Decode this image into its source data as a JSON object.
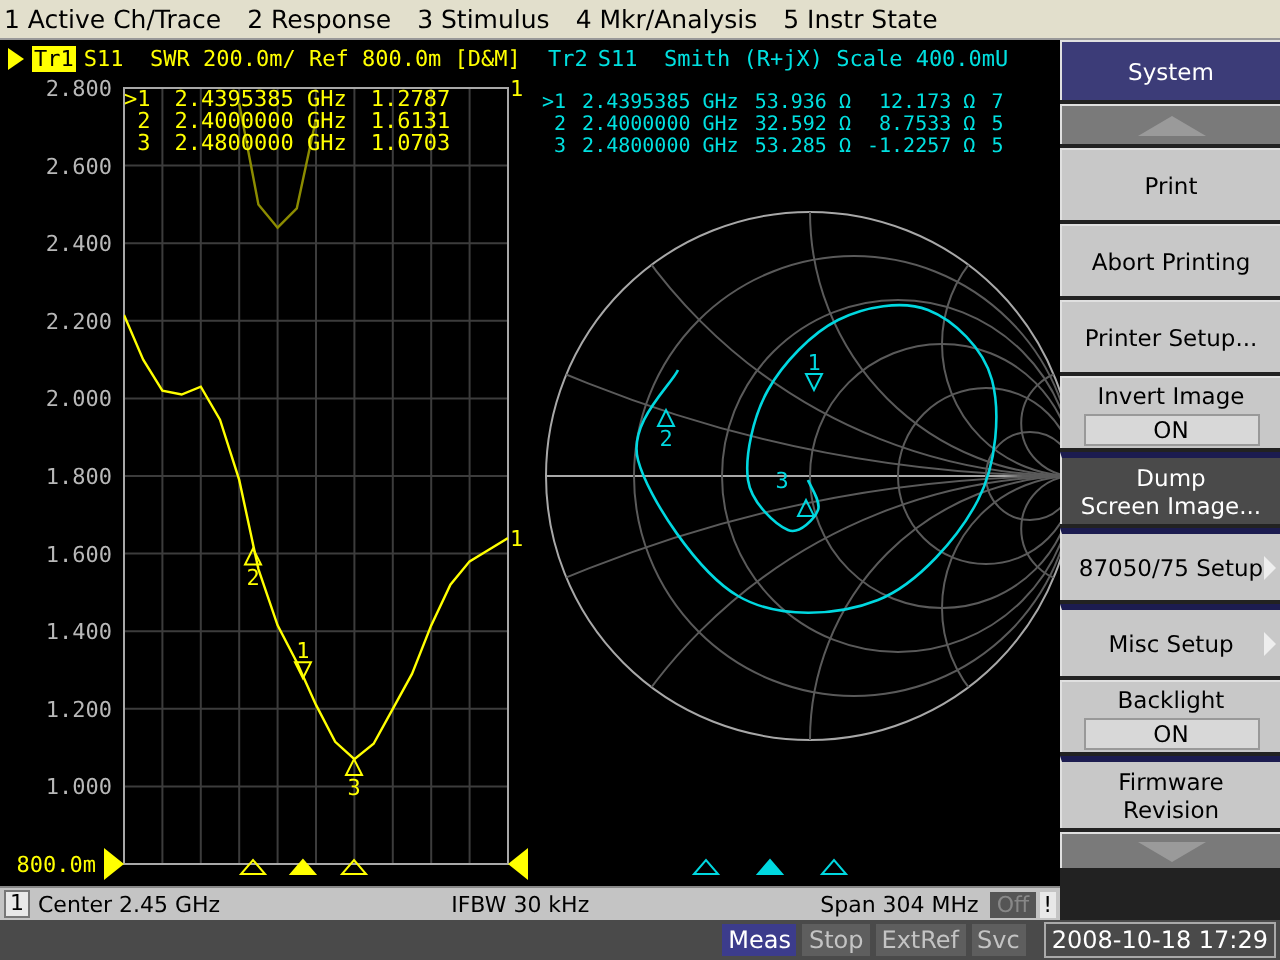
{
  "menu_bar": [
    "1 Active Ch/Trace",
    "2 Response",
    "3 Stimulus",
    "4 Mkr/Analysis",
    "5 Instr State"
  ],
  "trace1": {
    "label": "Tr1",
    "active": true,
    "header": "S11  SWR 200.0m/ Ref 800.0m [D&M]",
    "ref_value": "800.0m",
    "channel_marks": [
      "1",
      "1"
    ],
    "markers": [
      {
        "label": ">1",
        "frequency": "2.4395385 GHz",
        "value": "1.2787",
        "selected": true
      },
      {
        "label": "2",
        "frequency": "2.4000000 GHz",
        "value": "1.6131",
        "selected": false
      },
      {
        "label": "3",
        "frequency": "2.4800000 GHz",
        "value": "1.0703",
        "selected": false
      }
    ],
    "marker_labels": [
      "1",
      "2",
      "3"
    ],
    "chart_data": {
      "type": "line",
      "grid": true,
      "ylim": [
        0.8,
        2.8
      ],
      "yticks": [
        {
          "value": 2.8,
          "label": "2.800"
        },
        {
          "value": 2.6,
          "label": "2.600"
        },
        {
          "value": 2.4,
          "label": "2.400"
        },
        {
          "value": 2.2,
          "label": "2.200"
        },
        {
          "value": 2.0,
          "label": "2.000"
        },
        {
          "value": 1.8,
          "label": "1.800"
        },
        {
          "value": 1.6,
          "label": "1.600"
        },
        {
          "value": 1.4,
          "label": "1.400"
        },
        {
          "value": 1.2,
          "label": "1.200"
        },
        {
          "value": 1.0,
          "label": "1.000"
        }
      ],
      "series": [
        {
          "color": "#ffff00",
          "values": [
            2.215,
            2.1,
            2.02,
            2.01,
            2.03,
            1.945,
            1.79,
            1.56,
            1.415,
            1.32,
            1.21,
            1.115,
            1.07,
            1.11,
            1.2,
            1.29,
            1.415,
            1.52,
            1.58,
            1.61,
            1.64
          ]
        },
        {
          "color": "#8c8c00",
          "values": [
            null,
            null,
            null,
            null,
            null,
            null,
            2.76,
            2.5,
            2.44,
            2.49,
            2.72,
            null,
            null,
            null,
            null,
            null,
            null,
            null,
            null,
            null,
            null
          ]
        }
      ]
    }
  },
  "trace2": {
    "label": "Tr2",
    "active": false,
    "header": "S11  Smith (R+jX) Scale 400.0mU",
    "markers": [
      {
        "label": ">1",
        "frequency": "2.4395385 GHz",
        "resistance": "53.936 Ω",
        "reactance": "12.173 Ω",
        "column_5": "7",
        "selected": true
      },
      {
        "label": "2",
        "frequency": "2.4000000 GHz",
        "resistance": "32.592 Ω",
        "reactance": "8.7533 Ω",
        "column_5": "5",
        "selected": false
      },
      {
        "label": "3",
        "frequency": "2.4800000 GHz",
        "resistance": "53.285 Ω",
        "reactance": "-1.2257 Ω",
        "column_5": "5",
        "selected": false
      }
    ],
    "marker_labels": [
      "1",
      "2",
      "3"
    ]
  },
  "status_line": {
    "channel": "1",
    "center": "Center 2.45 GHz",
    "ifbw": "IFBW 30 kHz",
    "span": "Span 304 MHz",
    "off": "Off",
    "alert": "!"
  },
  "softkeys": [
    {
      "kind": "header",
      "lines": [
        "System"
      ],
      "selected": false
    },
    {
      "kind": "scroll_up",
      "selected": false
    },
    {
      "kind": "button",
      "lines": [
        "Print"
      ],
      "selected": false
    },
    {
      "kind": "button",
      "lines": [
        "Abort Printing"
      ],
      "selected": false
    },
    {
      "kind": "button",
      "lines": [
        "Printer Setup..."
      ],
      "selected": false
    },
    {
      "kind": "toggle",
      "lines": [
        "Invert Image"
      ],
      "value": "ON",
      "selected": false
    },
    {
      "kind": "button",
      "lines": [
        "Dump",
        "Screen Image..."
      ],
      "selected": true
    },
    {
      "kind": "submenu",
      "lines": [
        "87050/75 Setup"
      ],
      "selected": false
    },
    {
      "kind": "submenu",
      "lines": [
        "Misc Setup"
      ],
      "selected": false
    },
    {
      "kind": "toggle",
      "lines": [
        "Backlight"
      ],
      "value": "ON",
      "selected": false
    },
    {
      "kind": "button",
      "lines": [
        "Firmware",
        "Revision"
      ],
      "selected": false
    },
    {
      "kind": "scroll_down",
      "selected": false
    }
  ],
  "indicators": [
    {
      "label": "Meas",
      "on": true
    },
    {
      "label": "Stop",
      "on": false
    },
    {
      "label": "ExtRef",
      "on": false
    },
    {
      "label": "Svc",
      "on": false
    }
  ],
  "datetime": "2008-10-18 17:29"
}
